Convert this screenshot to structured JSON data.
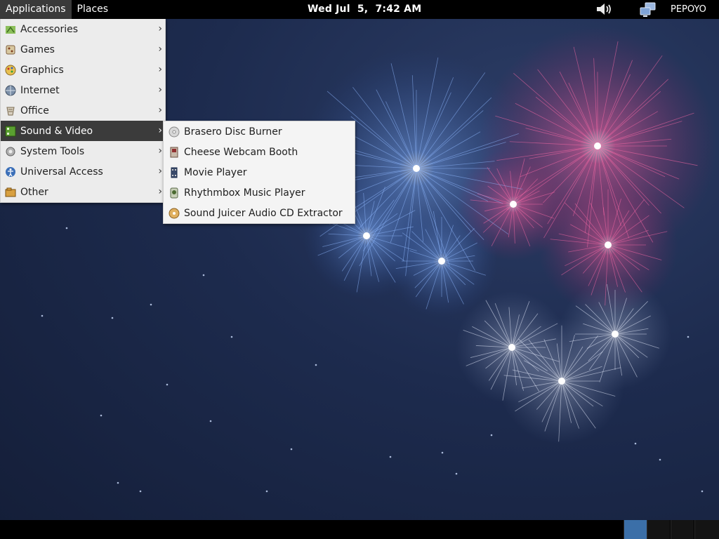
{
  "top_panel": {
    "applications_label": "Applications",
    "places_label": "Places",
    "clock": "Wed Jul  5,  7:42 AM",
    "username": "PEPOYO"
  },
  "app_menu": {
    "items": [
      {
        "label": "Accessories",
        "icon": "accessories-icon"
      },
      {
        "label": "Games",
        "icon": "games-icon"
      },
      {
        "label": "Graphics",
        "icon": "graphics-icon"
      },
      {
        "label": "Internet",
        "icon": "internet-icon"
      },
      {
        "label": "Office",
        "icon": "office-icon"
      },
      {
        "label": "Sound & Video",
        "icon": "sound-video-icon",
        "selected": true
      },
      {
        "label": "System Tools",
        "icon": "system-tools-icon"
      },
      {
        "label": "Universal Access",
        "icon": "universal-access-icon"
      },
      {
        "label": "Other",
        "icon": "other-icon"
      }
    ],
    "arrow": "›"
  },
  "sub_menu": {
    "items": [
      {
        "label": "Brasero Disc Burner",
        "icon": "disc-icon"
      },
      {
        "label": "Cheese Webcam Booth",
        "icon": "webcam-icon"
      },
      {
        "label": "Movie Player",
        "icon": "film-icon"
      },
      {
        "label": "Rhythmbox Music Player",
        "icon": "music-player-icon"
      },
      {
        "label": "Sound Juicer Audio CD Extractor",
        "icon": "cd-extractor-icon"
      }
    ]
  },
  "colors": {
    "panel": "#000000",
    "menu_bg": "#ececec",
    "selected_bg": "#3b3b3b",
    "workspace_active": "#3b6fa8"
  }
}
